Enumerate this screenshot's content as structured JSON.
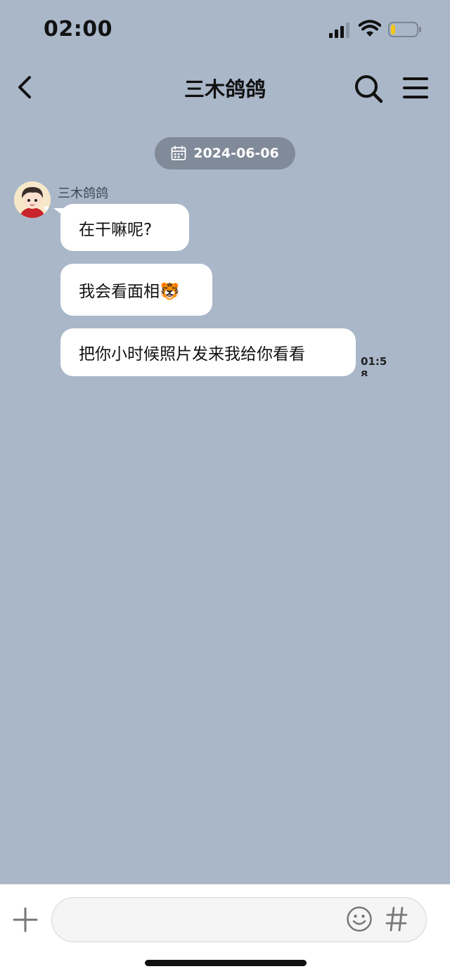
{
  "status_bar": {
    "time": "02:00",
    "signal_icon": "cellular-signal-icon",
    "wifi_icon": "wifi-icon",
    "battery_icon": "battery-low-icon",
    "battery_level": 0.18,
    "battery_color": "#f5c518"
  },
  "header": {
    "title": "三木鸽鸽",
    "back_icon": "chevron-left-icon",
    "search_icon": "search-icon",
    "menu_icon": "hamburger-menu-icon"
  },
  "date_pill": {
    "icon": "calendar-icon",
    "date": "2024-06-06"
  },
  "message_group": {
    "sender_name": "三木鸽鸽",
    "avatar_icon": "avatar-cartoon-boy",
    "messages": [
      {
        "text": "在干嘛呢?"
      },
      {
        "text": "我会看面相🐯"
      },
      {
        "text": "把你小时候照片发来我给你看看"
      }
    ],
    "time": "01:58"
  },
  "input_bar": {
    "plus_icon": "plus-icon",
    "placeholder": "",
    "emoji_icon": "smiley-icon",
    "hashtag_icon": "hashtag-icon"
  },
  "colors": {
    "chat_background": "#a9b7c9",
    "date_pill_background": "#808a99",
    "bubble_background": "#ffffff"
  }
}
